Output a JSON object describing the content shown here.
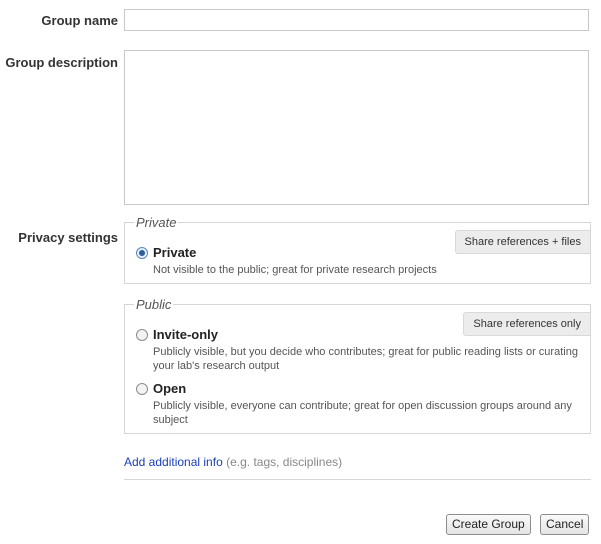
{
  "form": {
    "group_name_label": "Group name",
    "group_name_value": "",
    "group_description_label": "Group description",
    "group_description_value": "",
    "privacy_label": "Privacy settings"
  },
  "privacy": {
    "private_group": {
      "legend": "Private",
      "tag": "Share references + files",
      "options": [
        {
          "title": "Private",
          "description": "Not visible to the public; great for private research projects",
          "checked": true
        }
      ]
    },
    "public_group": {
      "legend": "Public",
      "tag": "Share references only",
      "options": [
        {
          "title": "Invite-only",
          "description": "Publicly visible, but you decide who contributes; great for public reading lists or curating your lab's research output",
          "checked": false
        },
        {
          "title": "Open",
          "description": "Publicly visible, everyone can contribute; great for open discussion groups around any subject",
          "checked": false
        }
      ]
    }
  },
  "additional_info": {
    "link_text": "Add additional info",
    "hint": "(e.g. tags, disciplines)"
  },
  "buttons": {
    "create": "Create Group",
    "cancel": "Cancel"
  },
  "colors": {
    "link": "#1a3fb8",
    "radio_checked": "#2d5f9a"
  }
}
